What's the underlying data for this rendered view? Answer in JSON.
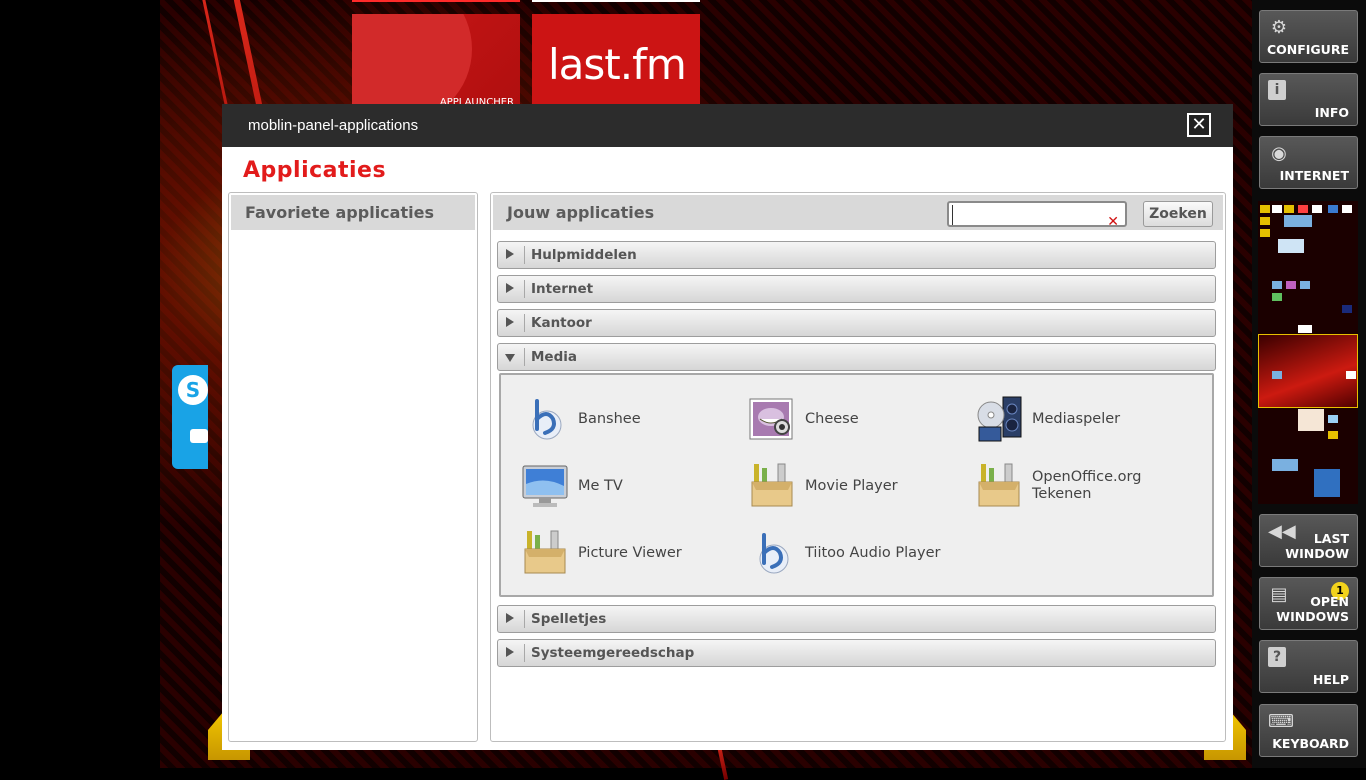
{
  "desktop": {
    "tiles": [
      {
        "name": "applauncher",
        "label": "APPLAUNCHER"
      },
      {
        "name": "lastfm",
        "label": "last.fm"
      }
    ]
  },
  "dialog": {
    "window_title": "moblin-panel-applications",
    "heading": "Applicaties",
    "favorites": {
      "title": "Favoriete applicaties"
    },
    "apps": {
      "title": "Jouw applicaties",
      "search": {
        "value": "",
        "placeholder": "",
        "button_label": "Zoeken"
      },
      "categories": [
        {
          "label": "Hulpmiddelen",
          "expanded": false
        },
        {
          "label": "Internet",
          "expanded": false
        },
        {
          "label": "Kantoor",
          "expanded": false
        },
        {
          "label": "Media",
          "expanded": true
        },
        {
          "label": "Spelletjes",
          "expanded": false
        },
        {
          "label": "Systeemgereedschap",
          "expanded": false
        }
      ],
      "media_items": [
        {
          "label": "Banshee",
          "icon": "banshee-icon"
        },
        {
          "label": "Cheese",
          "icon": "cheese-icon"
        },
        {
          "label": "Mediaspeler",
          "icon": "mediaplayer-icon"
        },
        {
          "label": "Me TV",
          "icon": "monitor-icon"
        },
        {
          "label": "Movie Player",
          "icon": "package-icon"
        },
        {
          "label": "OpenOffice.org Tekenen",
          "icon": "package-icon"
        },
        {
          "label": "Picture Viewer",
          "icon": "package-icon"
        },
        {
          "label": "Tiitoo Audio Player",
          "icon": "banshee-icon"
        }
      ]
    }
  },
  "panel": {
    "configure": "CONFIGURE",
    "info": "INFO",
    "internet": "INTERNET",
    "last_window": [
      "LAST",
      "WINDOW"
    ],
    "open_windows": [
      "OPEN",
      "WINDOWS"
    ],
    "open_windows_count": "1",
    "help": "HELP",
    "keyboard": "KEYBOARD"
  },
  "colors": {
    "accent": "#e21b1b",
    "titlebar": "#2c2c2c",
    "badge": "#f2d21c"
  }
}
